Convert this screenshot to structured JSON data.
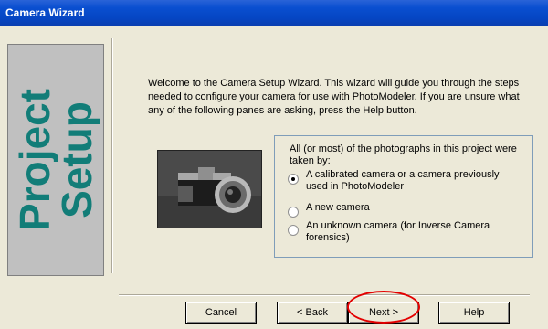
{
  "window": {
    "title": "Camera Wizard"
  },
  "left_panel": {
    "text_line1": "Project",
    "text_line2": "Setup"
  },
  "intro_text": "Welcome to the Camera Setup Wizard. This wizard will guide you through the steps needed to configure your camera for use with PhotoModeler.  If you are unsure what any of the following panes are asking, press the Help button.",
  "options": {
    "question": "All (or most) of the photographs in this project were taken by:",
    "items": [
      {
        "label": "A calibrated camera or a camera previously used in PhotoModeler",
        "selected": true
      },
      {
        "label": "A new camera",
        "selected": false
      },
      {
        "label": "An unknown camera (for Inverse Camera forensics)",
        "selected": false
      }
    ]
  },
  "buttons": {
    "cancel": "Cancel",
    "back": "< Back",
    "next": "Next >",
    "help": "Help"
  },
  "colors": {
    "panel_text": "#127d78",
    "titlebar": "#0a4fd0",
    "highlight": "#e30000"
  }
}
